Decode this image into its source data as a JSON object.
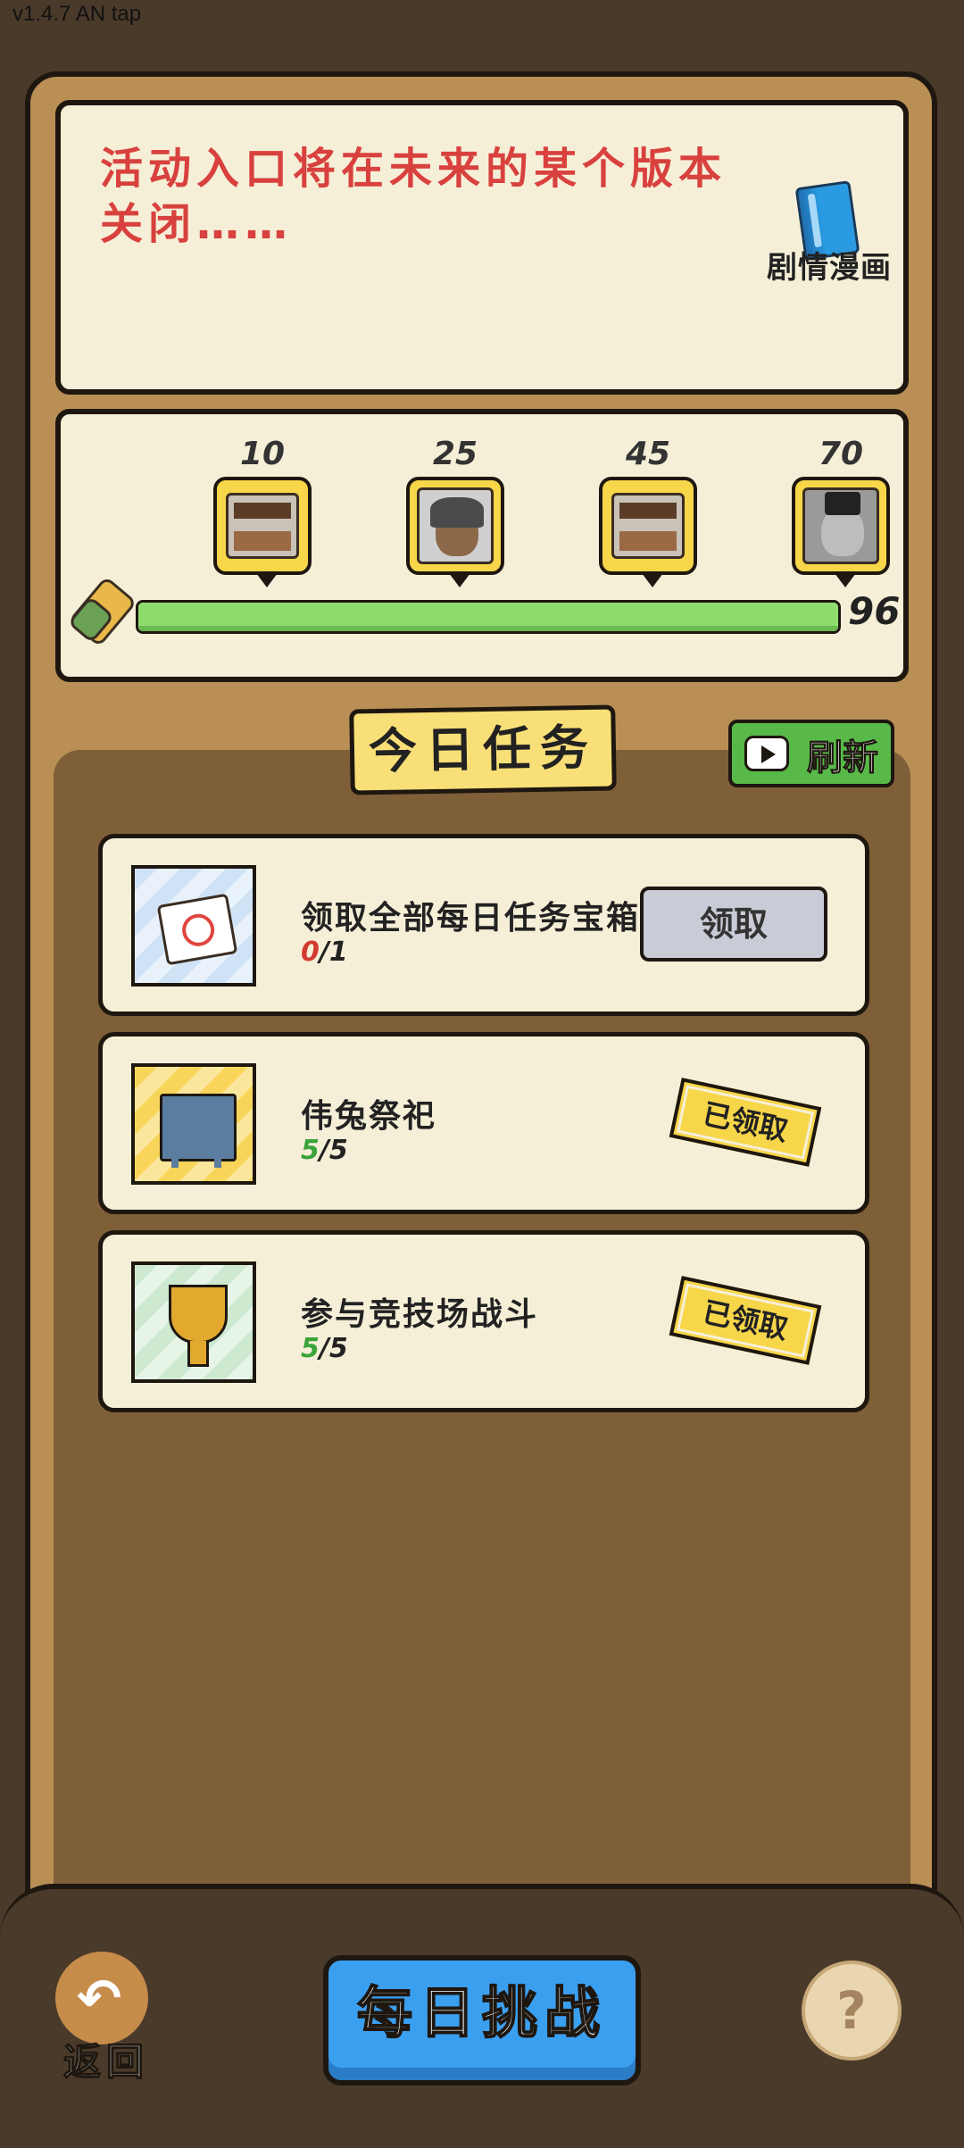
{
  "status": {
    "version": "v1.4.7 AN tap"
  },
  "notice": {
    "text": "活动入口将在未来的某个版本关闭……",
    "comic_label": "剧情漫画"
  },
  "progress": {
    "milestones": [
      {
        "value": "10",
        "reward": "chest"
      },
      {
        "value": "25",
        "reward": "character"
      },
      {
        "value": "45",
        "reward": "chest"
      },
      {
        "value": "70",
        "reward": "cat-character"
      }
    ],
    "current": "96",
    "fill_fraction": 1.0
  },
  "tasks_header": {
    "title": "今日任务",
    "refresh_label": "刷新"
  },
  "tasks": [
    {
      "name": "领取全部每日任务宝箱",
      "done": "0",
      "total": "/1",
      "action": "领取",
      "state": "claimable"
    },
    {
      "name": "伟兔祭祀",
      "done": "5",
      "total": "/5",
      "action": "已领取",
      "state": "claimed"
    },
    {
      "name": "参与竞技场战斗",
      "done": "5",
      "total": "/5",
      "action": "已领取",
      "state": "claimed"
    }
  ],
  "bottom": {
    "back_label": "返回",
    "challenge_label": "每日挑战",
    "help_label": "?"
  },
  "colors": {
    "accent_red": "#d8413e",
    "progress_green": "#8fdc6e",
    "challenge_blue": "#3b9ff0",
    "refresh_green": "#58b948"
  }
}
